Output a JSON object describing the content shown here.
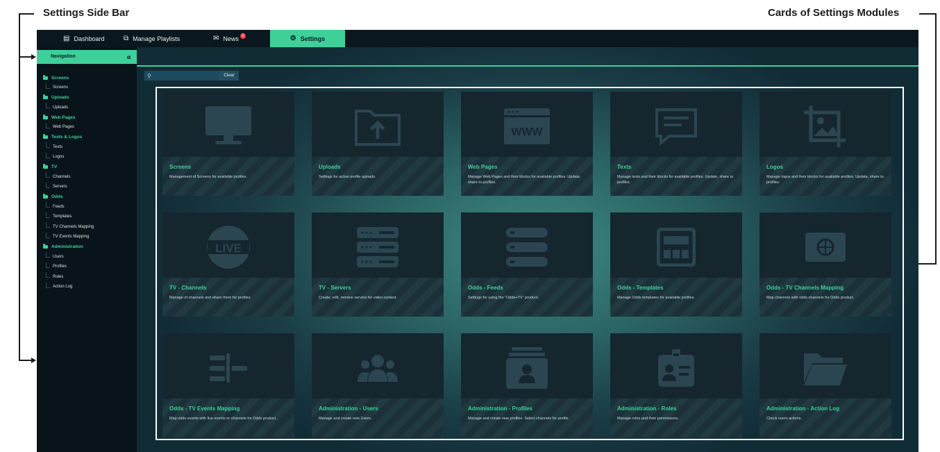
{
  "annotations": {
    "left_label": "Settings Side Bar",
    "right_label": "Cards of Settings Modules"
  },
  "topbar": {
    "tabs": [
      {
        "label": "Dashboard",
        "icon": "dashboard-icon"
      },
      {
        "label": "Manage Playlists",
        "icon": "playlists-icon"
      },
      {
        "label": "News",
        "icon": "envelope-icon",
        "badge": "3"
      },
      {
        "label": "Settings",
        "icon": "gear-icon",
        "active": true
      }
    ]
  },
  "sidebar": {
    "title": "Navigation",
    "collapse_icon": "«",
    "groups": [
      {
        "label": "Screens",
        "items": [
          "Screens"
        ]
      },
      {
        "label": "Uploads",
        "items": [
          "Uploads"
        ]
      },
      {
        "label": "Web Pages",
        "items": [
          "Web Pages"
        ]
      },
      {
        "label": "Texts & Logos",
        "items": [
          "Texts",
          "Logos"
        ]
      },
      {
        "label": "TV",
        "items": [
          "Channels",
          "Servers"
        ]
      },
      {
        "label": "Odds",
        "items": [
          "Feeds",
          "Templates",
          "TV Channels Mapping",
          "TV Events Mapping"
        ]
      },
      {
        "label": "Administration",
        "items": [
          "Users",
          "Profiles",
          "Roles",
          "Action Log"
        ]
      }
    ]
  },
  "search": {
    "placeholder": "",
    "clear_label": "Clear"
  },
  "cards": [
    {
      "title": "Screens",
      "desc": "Management of Screens for available profiles.",
      "icon": "monitor-icon"
    },
    {
      "title": "Uploads",
      "desc": "Settings for active profile uploads.",
      "icon": "folder-upload-icon"
    },
    {
      "title": "Web Pages",
      "desc": "Manage Web Pages and their blocks for available profiles. Update, share to profiles.",
      "icon": "www-icon"
    },
    {
      "title": "Texts",
      "desc": "Manage texts and their blocks for available profiles. Update, share to profiles.",
      "icon": "text-message-icon"
    },
    {
      "title": "Logos",
      "desc": "Manage logos and their blocks for available profiles. Update, share to profiles.",
      "icon": "image-crop-icon"
    },
    {
      "title": "TV - Channels",
      "desc": "Manage of channels and share them for profiles.",
      "icon": "live-icon"
    },
    {
      "title": "TV - Servers",
      "desc": "Create, edit, remove servers for video content.",
      "icon": "server-icon"
    },
    {
      "title": "Odds - Feeds",
      "desc": "Settings for using the \"Odds+TV\" product.",
      "icon": "feed-list-icon"
    },
    {
      "title": "Odds - Templates",
      "desc": "Manage Odds templates for available profiles.",
      "icon": "template-icon"
    },
    {
      "title": "Odds - TV Channels Mapping",
      "desc": "Map channels with odds channels for Odds product.",
      "icon": "channel-globe-icon"
    },
    {
      "title": "Odds - TV Events Mapping",
      "desc": "Map odds events with live events or channels for Odds product.",
      "icon": "events-mapping-icon"
    },
    {
      "title": "Administration - Users",
      "desc": "Manage and create new Users.",
      "icon": "users-icon"
    },
    {
      "title": "Administration - Profiles",
      "desc": "Manage and create new profiles. Select channels for profile.",
      "icon": "profile-card-icon"
    },
    {
      "title": "Administration - Roles",
      "desc": "Manage roles and their permissions.",
      "icon": "id-badge-icon"
    },
    {
      "title": "Administration - Action Log",
      "desc": "Check users actions.",
      "icon": "open-folder-icon"
    }
  ]
}
